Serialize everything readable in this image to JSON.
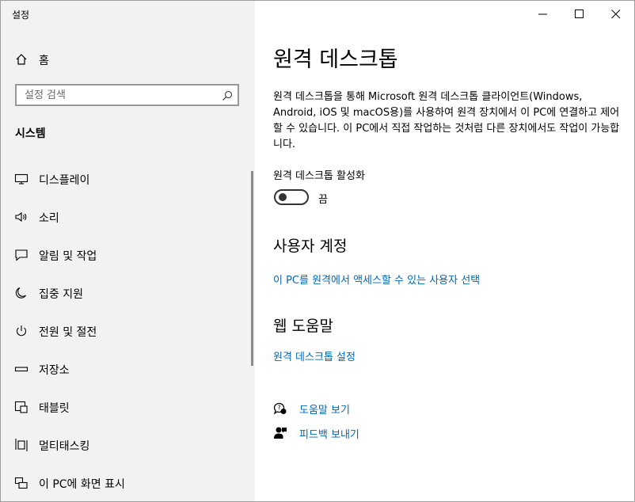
{
  "window": {
    "title": "설정"
  },
  "sidebar": {
    "home_label": "홈",
    "search_placeholder": "설정 검색",
    "section_title": "시스템",
    "items": [
      {
        "label": "디스플레이",
        "icon": "monitor-icon"
      },
      {
        "label": "소리",
        "icon": "speaker-icon"
      },
      {
        "label": "알림 및 작업",
        "icon": "notification-icon"
      },
      {
        "label": "집중 지원",
        "icon": "moon-icon"
      },
      {
        "label": "전원 및 절전",
        "icon": "power-icon"
      },
      {
        "label": "저장소",
        "icon": "storage-icon"
      },
      {
        "label": "태블릿",
        "icon": "tablet-icon"
      },
      {
        "label": "멀티태스킹",
        "icon": "multitasking-icon"
      },
      {
        "label": "이 PC에 화면 표시",
        "icon": "project-icon"
      }
    ]
  },
  "main": {
    "title": "원격 데스크톱",
    "description": "원격 데스크톱을 통해 Microsoft 원격 데스크톱 클라이언트(Windows, Android, iOS 및 macOS용)를 사용하여 원격 장치에서 이 PC에 연결하고 제어할 수 있습니다. 이 PC에서 직접 작업하는 것처럼 다른 장치에서도 작업이 가능합니다.",
    "toggle_caption": "원격 데스크톱 활성화",
    "toggle_state": "끔",
    "toggle_on": false,
    "user_accounts_heading": "사용자 계정",
    "user_accounts_link": "이 PC를 원격에서 액세스할 수 있는 사용자 선택",
    "web_help_heading": "웹 도움말",
    "web_help_link": "원격 데스크톱 설정",
    "get_help_label": "도움말 보기",
    "feedback_label": "피드백 보내기"
  },
  "colors": {
    "accent": "#0067b8",
    "sidebar_bg": "#f2f2f2"
  }
}
